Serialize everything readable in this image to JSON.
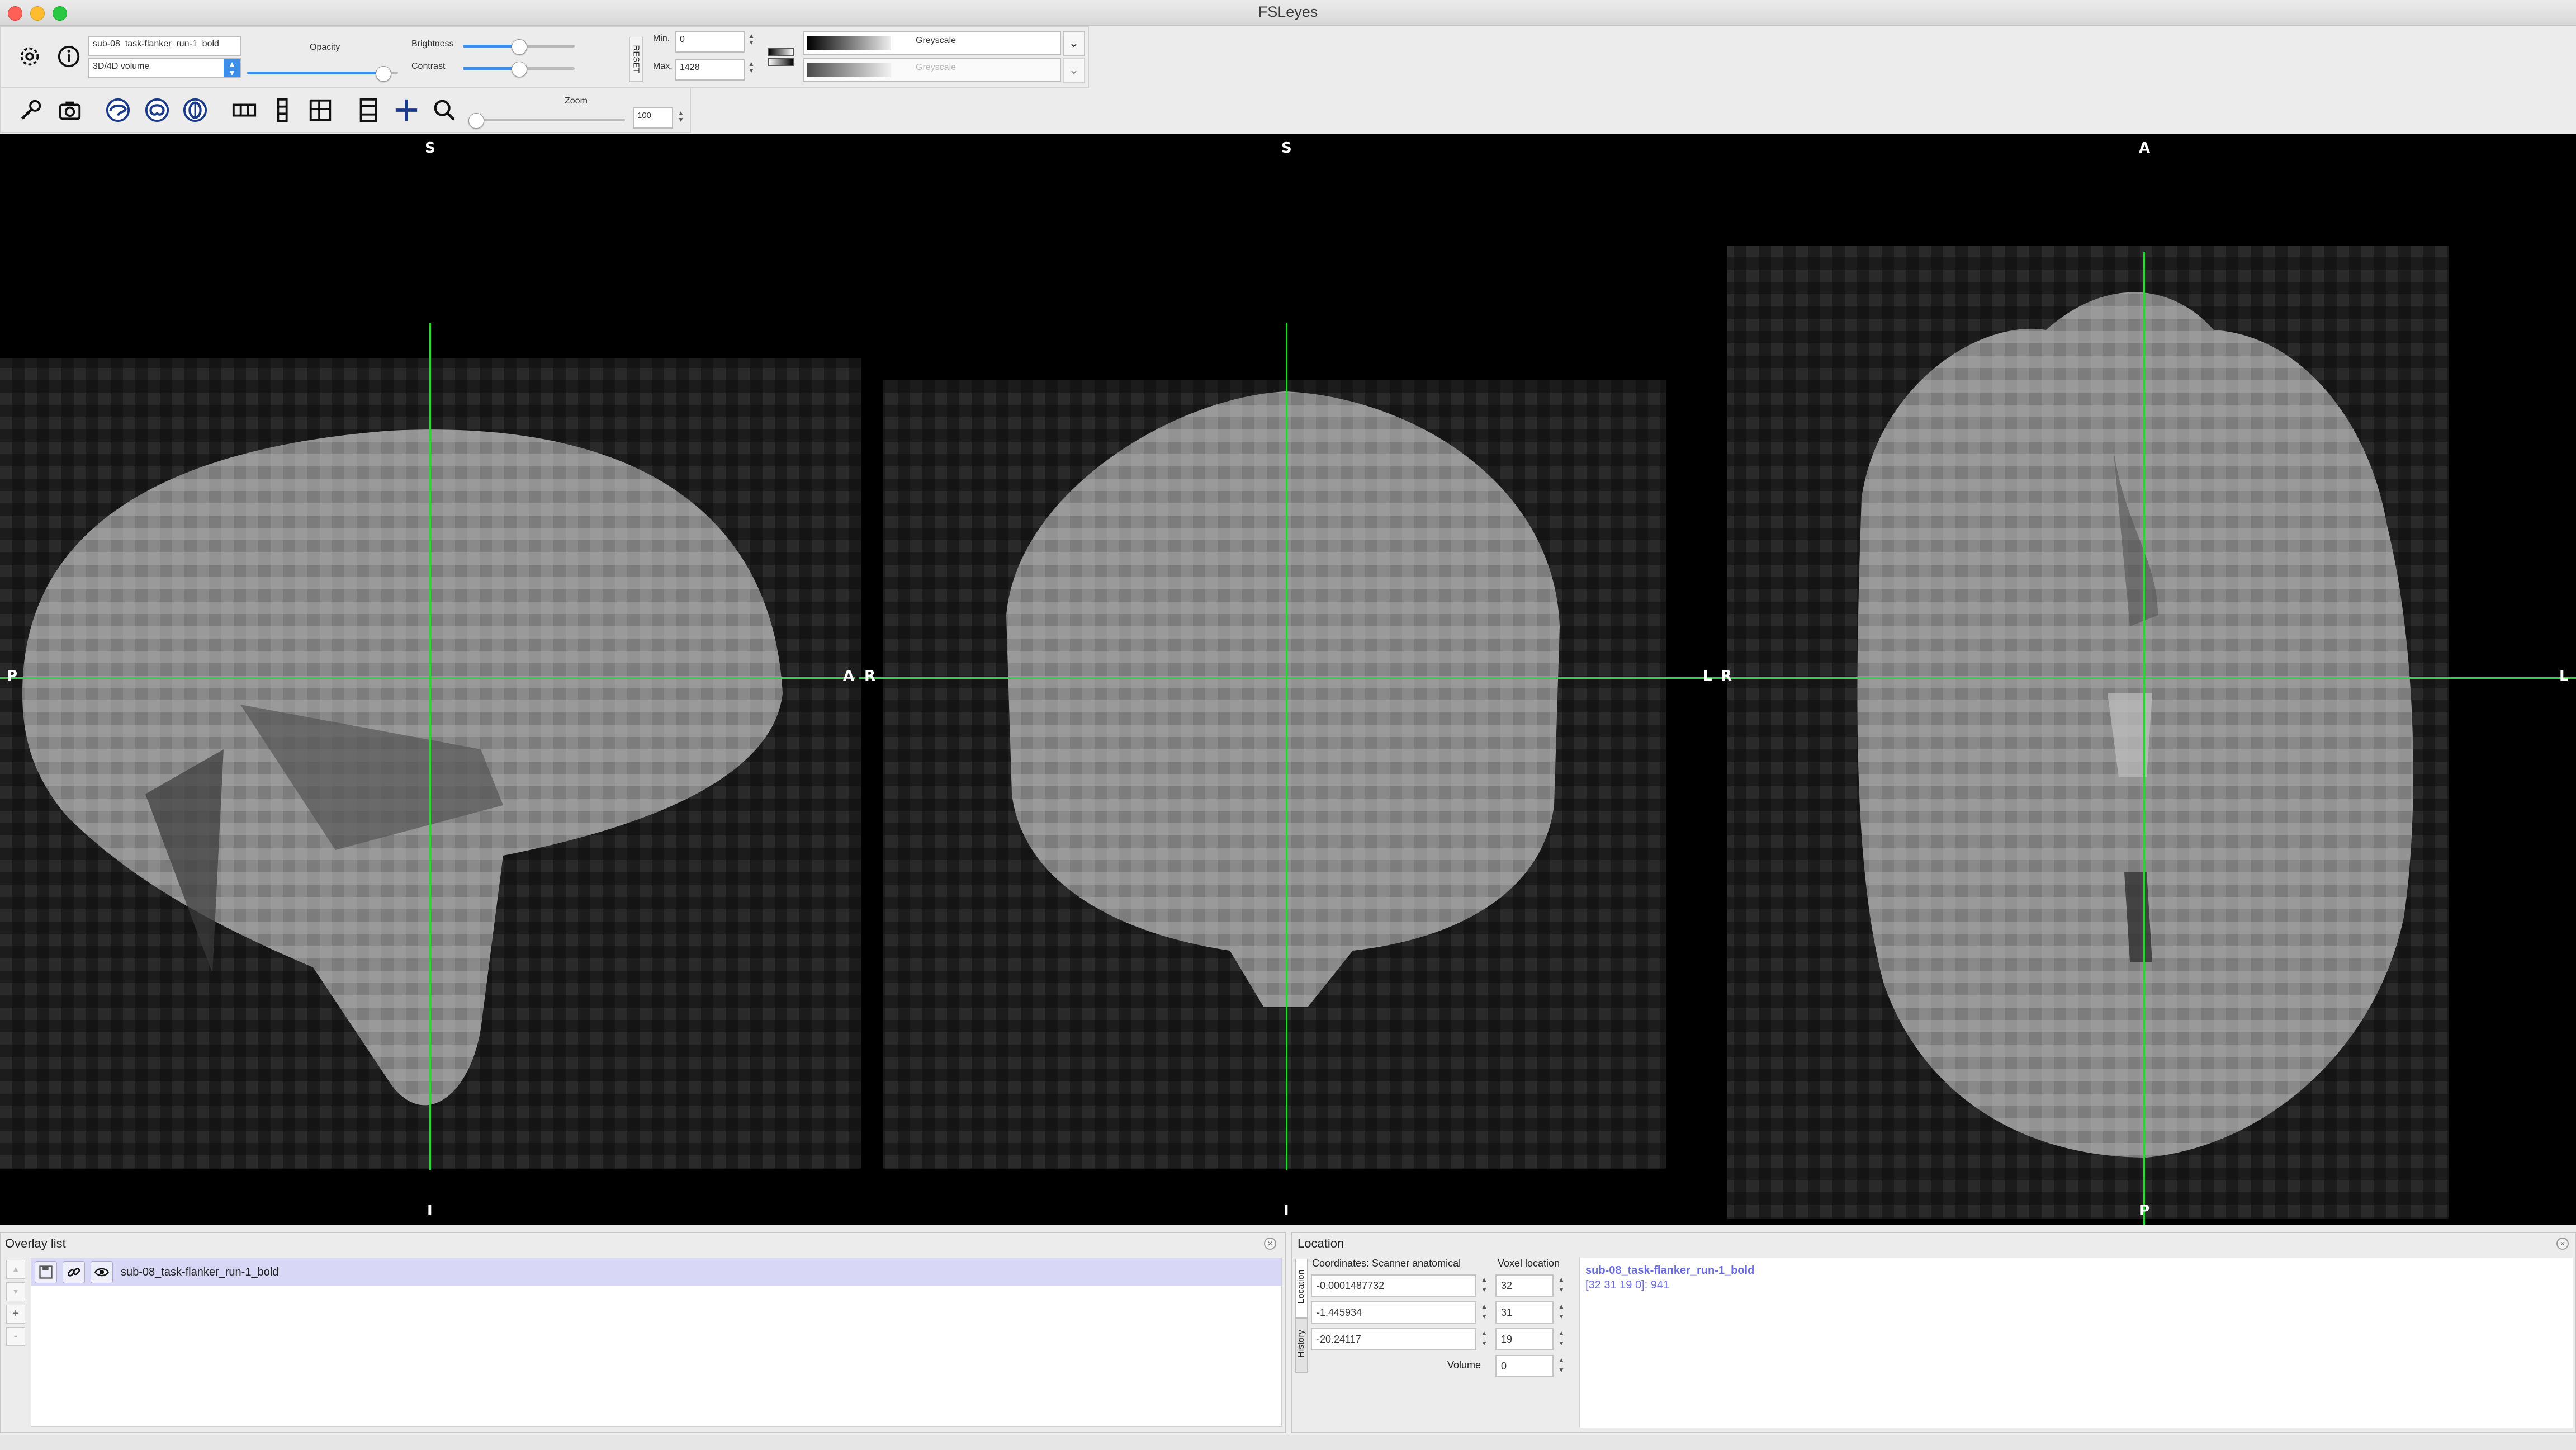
{
  "window": {
    "title": "FSLeyes"
  },
  "overlay_toolbar": {
    "overlay_name": "sub-08_task-flanker_run-1_bold",
    "overlay_type": "3D/4D volume",
    "opacity_label": "Opacity",
    "brightness_label": "Brightness",
    "contrast_label": "Contrast",
    "reset_label": "RESET",
    "min_label": "Min.",
    "max_label": "Max.",
    "min_value": "0",
    "max_value": "1428",
    "cmap_primary": "Greyscale",
    "cmap_negative": "Greyscale",
    "opacity_level": 0.9,
    "brightness_level": 0.5,
    "contrast_level": 0.5
  },
  "ortho_toolbar": {
    "zoom_label": "Zoom",
    "zoom_value": "100",
    "zoom_level": 0.0
  },
  "views": {
    "sagittal": {
      "top": "S",
      "bottom": "I",
      "left": "P",
      "right": "A"
    },
    "coronal": {
      "top": "S",
      "bottom": "I",
      "left": "R",
      "right": "L"
    },
    "axial": {
      "top": "A",
      "bottom": "P",
      "left": "R",
      "right": "L"
    }
  },
  "overlay_list": {
    "title": "Overlay list",
    "items": [
      {
        "name": "sub-08_task-flanker_run-1_bold"
      }
    ],
    "buttons": {
      "up": "▲",
      "down": "▼",
      "add": "+",
      "remove": "-"
    }
  },
  "location_panel": {
    "title": "Location",
    "tab_location": "Location",
    "tab_history": "History",
    "coords_header": "Coordinates: Scanner anatomical",
    "voxel_header": "Voxel location",
    "world_coords": [
      "-0.0001487732",
      "-1.445934",
      "-20.24117"
    ],
    "voxel_coords": [
      "32",
      "31",
      "19"
    ],
    "volume_label": "Volume",
    "volume_value": "0",
    "info_name": "sub-08_task-flanker_run-1_bold",
    "info_value": "[32 31 19 0]: 941"
  },
  "colors": {
    "crosshair": "#2ed23a",
    "selection": "#d8d8f6",
    "info_text": "#6a6adf",
    "accent": "#3d8ee8"
  }
}
